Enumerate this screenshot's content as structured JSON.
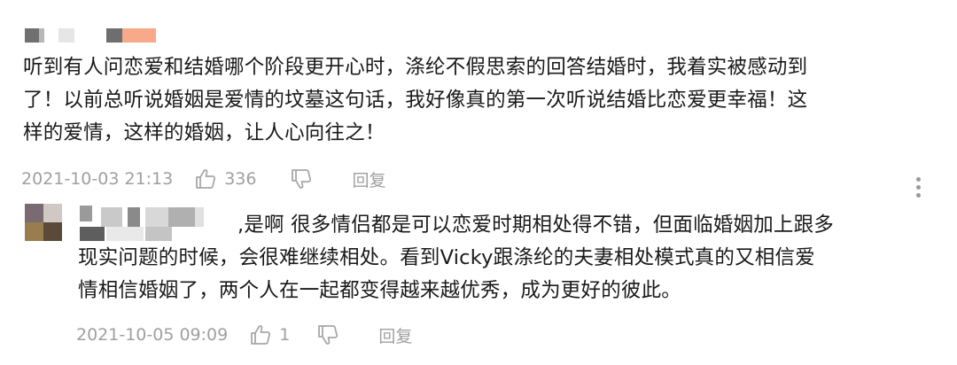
{
  "comments": [
    {
      "text_lines": [
        "听到有人问恋爱和结婚哪个阶段更开心时，涤纶不假思索的回答结婚时，我着实被感动到",
        "了！以前总听说婚姻是爱情的坟墓这句话，我好像真的第一次听说结婚比恋爱更幸福！这",
        "样的爱情，这样的婚姻，让人心向往之！"
      ],
      "date": "2021-10-03 21:13",
      "likes": "336",
      "reply_label": "回复"
    },
    {
      "text_lines": [
        ",是啊 很多情侣都是可以恋爱时期相处得不错，但面临婚姻加上跟多",
        "现实问题的时候，会很难继续相处。看到Vicky跟涤纶的夫妻相处模式真的又相信爱",
        "情相信婚姻了，两个人在一起都变得越来越优秀，成为更好的彼此。"
      ],
      "date": "2021-10-05 09:09",
      "likes": "1",
      "reply_label": "回复"
    }
  ],
  "icons": {
    "like": "thumbs-up-icon",
    "dislike": "thumbs-down-icon",
    "more": "more-vertical-icon"
  },
  "colors": {
    "text": "#1a1a1a",
    "meta": "#a0a0a0",
    "redaction_gray": "#707070",
    "redaction_light": "#e4e4e4",
    "redaction_orange": "#f7a98a"
  }
}
